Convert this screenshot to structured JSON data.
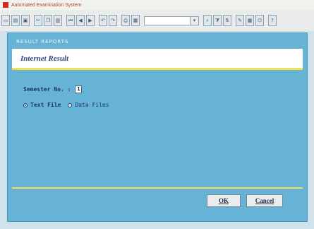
{
  "window": {
    "title": "Automated Examination System"
  },
  "toolbar": {
    "combo_value": "",
    "combo_arrow": "▾"
  },
  "dialog": {
    "section_label": "RESULT REPORTS",
    "header_title": "Internet Result",
    "semester": {
      "label": "Semester No. :",
      "value": "1"
    },
    "file_type": {
      "options": [
        {
          "label": "Text File",
          "checked": true
        },
        {
          "label": "Data Files",
          "checked": false
        }
      ]
    },
    "buttons": {
      "ok": "OK",
      "cancel": "Cancel"
    }
  },
  "colors": {
    "dialog_bg": "#67b3d6",
    "accent_yellow": "#f4e14d",
    "header_text": "#2d4a86"
  }
}
